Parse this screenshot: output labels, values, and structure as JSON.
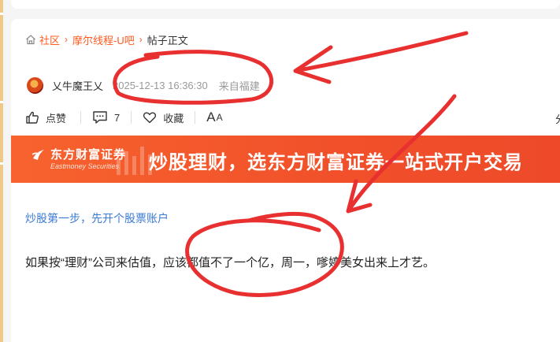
{
  "breadcrumb": {
    "home": "社区",
    "forum": "摩尔线程-U吧",
    "current": "帖子正文"
  },
  "post": {
    "author": "乂牛魔王乂",
    "time": "2025-12-13 16:36:30",
    "from": "来自福建",
    "body": "如果按“理财”公司来估值，应该都值不了一个亿，周一，嗲婷美女出来上才艺。"
  },
  "actions": {
    "like": "点赞",
    "comment_count": "7",
    "favorite": "收藏",
    "font_large": "A",
    "font_small": "A",
    "share": "分"
  },
  "banner": {
    "logo_cn": "东方财富证券",
    "logo_en": "Eastmoney Securities",
    "headline": "炒股理财，选东方财富证券一站式开户交易"
  },
  "promo_link": "炒股第一步，先开个股票账户",
  "colors": {
    "accent": "#ff5a1f",
    "banner": "#f1502a",
    "link": "#3a7bd5",
    "annotation": "#e83030"
  }
}
